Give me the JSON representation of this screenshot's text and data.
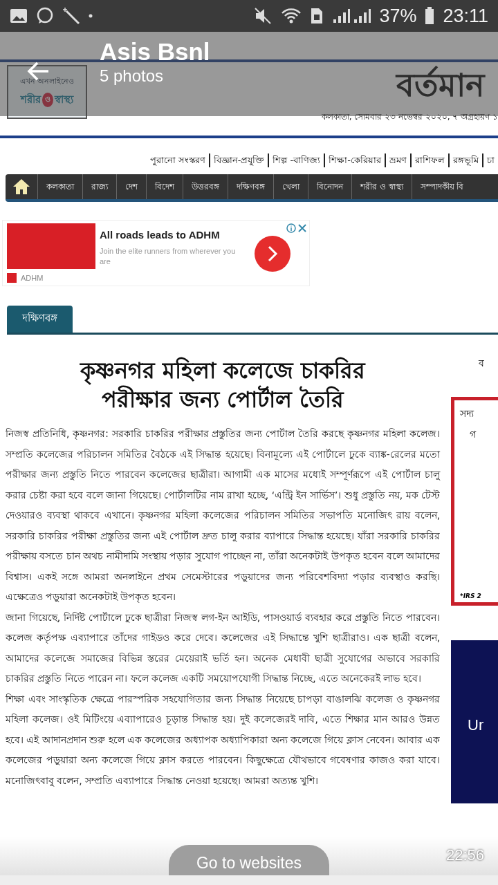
{
  "status_bar": {
    "battery": "37%",
    "time": "23:11"
  },
  "app_bar": {
    "title": "Asis Bsnl",
    "subtitle": "5 photos"
  },
  "page": {
    "logo": {
      "tagline": "এখন অনলাইনেও",
      "name_start": "শরীর",
      "heart_text": "ও",
      "name_end": "স্বাস্থ্য"
    },
    "masthead": "বর্তমান",
    "dateline": "কলকাতা, সোমবার ২৩ নভেম্বর ২০২০, ৭ অগ্রহায়ণ ১",
    "top_links": [
      "পুরানো সংস্করণ",
      "বিজ্ঞান-প্রযুক্তি",
      "শিল্প -বাণিজ্য",
      "শিক্ষা-কেরিয়ার",
      "ভ্রমণ",
      "রাশিফল",
      "রঙ্গভূমি",
      "চা"
    ],
    "nav_items": [
      "কলকাতা",
      "রাজ্য",
      "দেশ",
      "বিদেশ",
      "উত্তরবঙ্গ",
      "দক্ষিণবঙ্গ",
      "খেলা",
      "বিনোদন",
      "শরীর ও স্বাস্থ্য",
      "সম্পাদকীয় বি"
    ],
    "ad": {
      "headline": "All roads leads to ADHM",
      "text": "Join the elite runners from wherever you are",
      "advertiser": "ADHM"
    },
    "section_tab": "দক্ষিণবঙ্গ",
    "article": {
      "headline": "কৃষ্ণনগর মহিলা কলেজে চাকরির পরীক্ষার জন্য পোর্টাল তৈরি",
      "paragraphs": [
        "নিজস্ব প্রতিনিধি, কৃষ্ণনগর: সরকারি চাকরির পরীক্ষার প্রস্তুতির জন্য পোর্টাল তৈরি করছে কৃষ্ণনগর মহিলা কলেজ। সম্প্রতি কলেজের পরিচালন সমিতির বৈঠকে এই সিদ্ধান্ত হয়েছে। বিনামূল্যে এই পোর্টালে ঢুকে ব্যাঙ্ক-রেলের মতো পরীক্ষার জন্য প্রস্তুতি নিতে পারবেন কলেজের ছাত্রীরা। আগামী এক মাসের মধ্যেই সম্পূর্ণরূপে এই পোর্টাল চালু করার চেষ্টা করা হবে বলে জানা গিয়েছে। পোর্টালটির নাম রাখা হচ্ছে, ‘এন্ট্রি ইন সার্ভিস’। শুধু প্রস্তুতি নয়, মক টেস্ট দেওয়ারও ব্যবস্থা থাকবে এখানে। কৃষ্ণনগর মহিলা কলেজের পরিচালন সমিতির সভাপতি মনোজিৎ রায় বলেন, সরকারি চাকরির পরীক্ষা প্রস্তুতির জন্য এই পোর্টাল দ্রুত চালু করার ব্যাপারে সিদ্ধান্ত হয়েছে। যাঁরা সরকারি চাকরির পরীক্ষায় বসতে চান অথচ নামীদামি সংস্থায় পড়ার সুযোগ পাচ্ছেন না, তাঁরা অনেকটাই উপকৃত হবেন বলে আমাদের বিশ্বাস। একই সঙ্গে আমরা অনলাইনে প্রথম সেমেস্টারের পড়ুয়াদের জন্য পরিবেশবিদ্যা পড়ার ব্যবস্থাও করছি। এক্ষেত্রেও পড়ুয়ারা অনেকটাই উপকৃত হবেন।",
        "জানা গিয়েছে, নির্দিষ্ট পোর্টালে ঢুকে ছাত্রীরা নিজস্ব লগ-ইন আইডি, পাসওয়ার্ড ব্যবহার করে প্রস্তুতি নিতে পারবেন। কলেজ কর্তৃপক্ষ এব্যাপারে তাঁদের গাইডও করে দেবে। কলেজের এই সিদ্ধান্তে খুশি ছাত্রীরাও। এক ছাত্রী বলেন, আমাদের কলেজে সমাজের বিভিন্ন স্তরের মেয়েরাই ভর্তি হন। অনেক মেধাবী ছাত্রী সুযোগের অভাবে সরকারি চাকরির প্রস্তুতি নিতে পারেন না। ফলে কলেজ একটি সময়োপযোগী সিদ্ধান্ত নিচ্ছে, এতে অনেকেরই লাভ হবে।",
        "শিক্ষা এবং সাংস্কৃতিক ক্ষেত্রে পারস্পরিক সহযোগিতার জন্য সিদ্ধান্ত নিয়েছে চাপড়া বাঙালঝি কলেজ ও কৃষ্ণনগর মহিলা কলেজ। ওই মিটিংয়ে এব্যাপারেও চূড়ান্ত সিদ্ধান্ত হয়। দুই কলেজেরই দাবি, এতে শিক্ষার মান আরও উন্নত হবে। এই আদানপ্রদান শুরু হলে এক কলেজের অধ্যাপক অধ্যাপিকারা অন্য কলেজে গিয়ে ক্লাস নেবেন। আবার এক কলেজের পড়ুয়ারা অন্য কলেজে গিয়ে ক্লাস করতে পারবেন। কিছুক্ষেত্রে যৌথভাবে গবেষণার কাজও করা যাবে। মনোজিৎবাবু বলেন, সম্প্রতি এব্যাপারে সিদ্ধান্ত নেওয়া হয়েছে। আমরা অত্যন্ত খুশি।"
      ]
    },
    "sidebar": {
      "cut_heading": "ব",
      "box_line_1": "সদ্য",
      "box_line_2": "গ",
      "box_note": "*IRS 2",
      "banner_text": "Ur"
    }
  },
  "footer": {
    "button": "Go to websites",
    "timestamp": "22:56"
  }
}
